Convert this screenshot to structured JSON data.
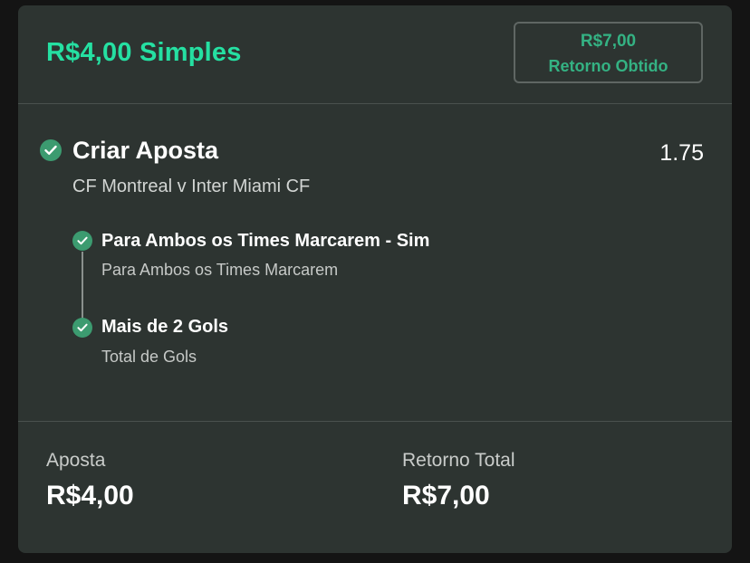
{
  "header": {
    "title": "R$4,00 Simples",
    "return_amount": "R$7,00",
    "return_label": "Retorno Obtido"
  },
  "bet": {
    "title": "Criar Aposta",
    "odds": "1.75",
    "event": "CF Montreal v Inter Miami CF",
    "status_icon": "check-circle-icon",
    "legs": [
      {
        "title": "Para Ambos os Times Marcarem - Sim",
        "subtitle": "Para Ambos os Times Marcarem"
      },
      {
        "title": "Mais de 2 Gols",
        "subtitle": "Total de Gols"
      }
    ]
  },
  "footer": {
    "stake_label": "Aposta",
    "stake_value": "R$4,00",
    "total_return_label": "Retorno Total",
    "total_return_value": "R$7,00"
  },
  "colors": {
    "background": "#141414",
    "card": "#2d3431",
    "accent_green": "#25e0a2",
    "check_green": "#3c9b70",
    "return_green": "#34b283"
  }
}
